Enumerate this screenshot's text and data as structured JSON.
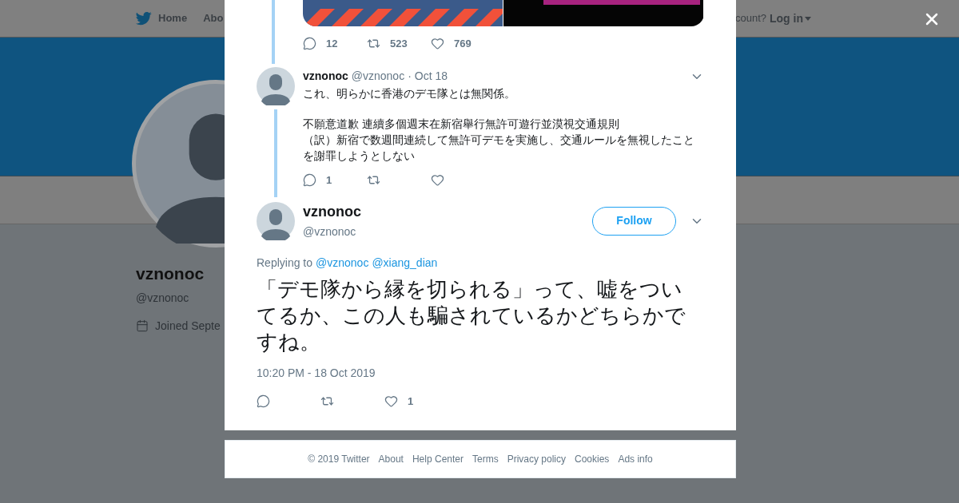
{
  "nav": {
    "items": [
      {
        "label": "Home"
      },
      {
        "label": "Abo"
      }
    ],
    "login_prompt": "count?",
    "login": "Log in"
  },
  "profile": {
    "name": "vznonoc",
    "handle": "@vznonoc",
    "joined": "Joined Septe"
  },
  "thread": {
    "top_tweet": {
      "actions": {
        "replies": "12",
        "retweets": "523",
        "likes": "769"
      }
    },
    "reply": {
      "name": "vznonoc",
      "handle": "@vznonoc",
      "separator": "·",
      "date": "Oct 18",
      "paragraphs": [
        [
          "これ、明らかに香港のデモ隊とは無関係。"
        ],
        [
          "不願意道歉 連續多個週末在新宿舉行無許可遊行並漠視交通規則",
          "（訳）新宿で数週間連続して無許可デモを実施し、交通ルールを無視したことを謝罪しようとしない"
        ]
      ],
      "actions": {
        "replies": "1"
      }
    }
  },
  "main_tweet": {
    "name": "vznonoc",
    "handle": "@vznonoc",
    "follow": "Follow",
    "replying_prefix": "Replying to",
    "mentions": [
      "@vznonoc",
      "@xiang_dian"
    ],
    "text": "「デモ隊から縁を切られる」って、嘘をついてるか、この人も騙されているかどちらかですね。",
    "timestamp": "10:20 PM - 18 Oct 2019",
    "actions": {
      "likes": "1"
    }
  },
  "footer": [
    "© 2019 Twitter",
    "About",
    "Help Center",
    "Terms",
    "Privacy policy",
    "Cookies",
    "Ads info"
  ]
}
